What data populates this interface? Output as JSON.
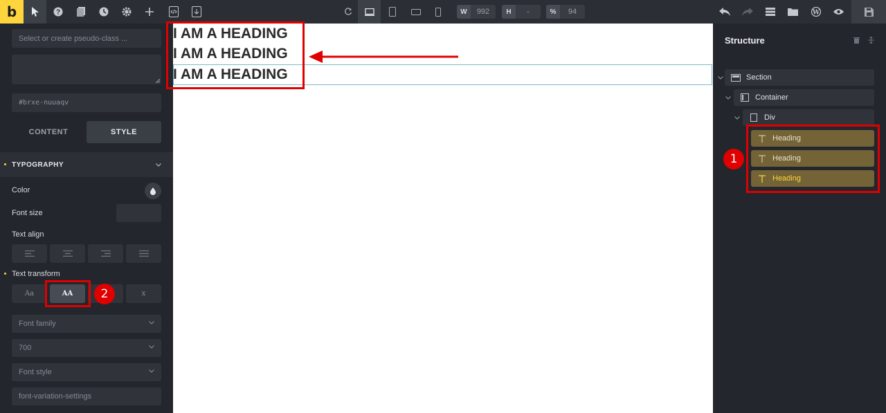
{
  "toolbar": {
    "logo": "b",
    "width_label": "W",
    "width_value": "992",
    "height_label": "H",
    "height_value": "-",
    "zoom_label": "%",
    "zoom_value": "94"
  },
  "left_panel": {
    "pseudo_placeholder": "Select or create pseudo-class ...",
    "css_id": "#brxe-nuuaqv",
    "tabs": {
      "content": "CONTENT",
      "style": "STYLE"
    },
    "typography_title": "TYPOGRAPHY",
    "color_label": "Color",
    "font_size_label": "Font size",
    "text_align_label": "Text align",
    "text_transform_label": "Text transform",
    "text_transform_options": [
      "Aa",
      "AA",
      "x"
    ],
    "font_family_placeholder": "Font family",
    "font_weight_value": "700",
    "font_style_placeholder": "Font style",
    "font_variation_placeholder": "font-variation-settings"
  },
  "canvas": {
    "headings": [
      "I AM A HEADING",
      "I AM A HEADING",
      "I AM A HEADING"
    ]
  },
  "structure": {
    "title": "Structure",
    "nodes": {
      "section": "Section",
      "container": "Container",
      "div": "Div",
      "headings": [
        "Heading",
        "Heading",
        "Heading"
      ]
    }
  },
  "annotations": {
    "badge_1": "1",
    "badge_2": "2"
  },
  "colors": {
    "accent": "#ffd53e",
    "annotation": "#e00000",
    "selected_node": "#736336"
  }
}
